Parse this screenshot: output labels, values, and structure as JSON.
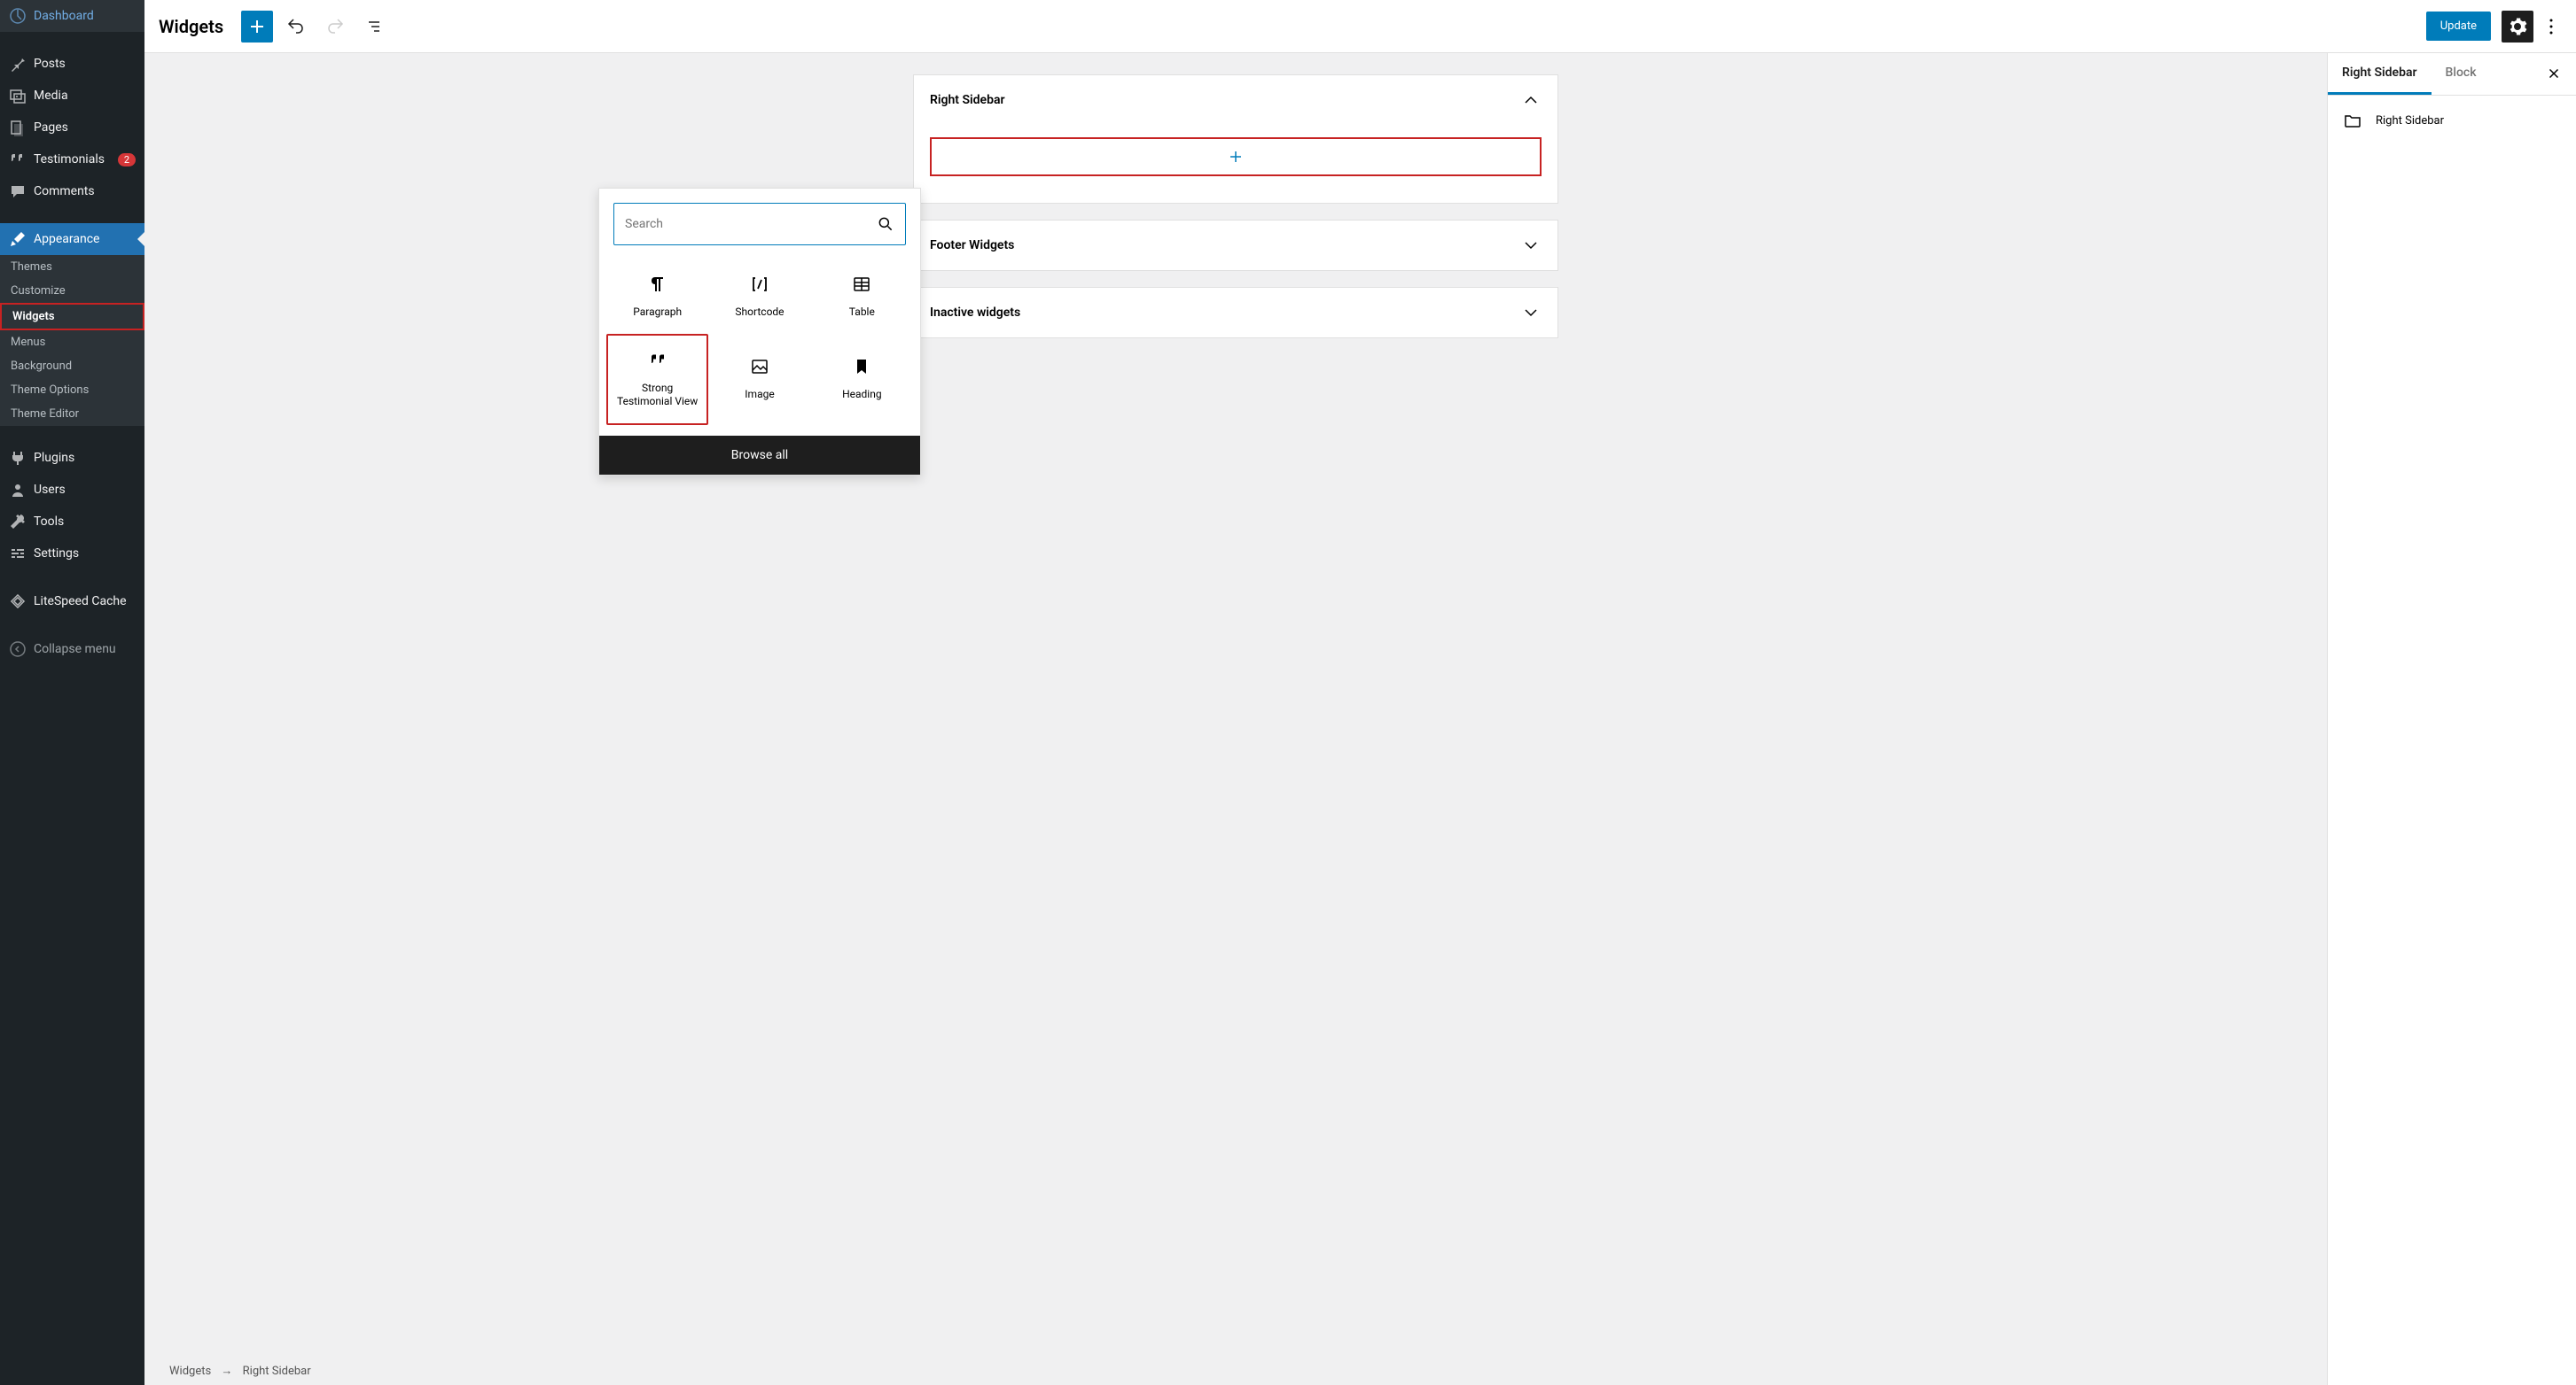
{
  "sidebar": {
    "items": [
      {
        "label": "Dashboard",
        "icon": "dashboard"
      },
      {
        "label": "Posts",
        "icon": "pin"
      },
      {
        "label": "Media",
        "icon": "media"
      },
      {
        "label": "Pages",
        "icon": "page"
      },
      {
        "label": "Testimonials",
        "icon": "quote",
        "badge": "2"
      },
      {
        "label": "Comments",
        "icon": "comment"
      },
      {
        "label": "Appearance",
        "icon": "brush",
        "active": true
      },
      {
        "label": "Plugins",
        "icon": "plug"
      },
      {
        "label": "Users",
        "icon": "user"
      },
      {
        "label": "Tools",
        "icon": "wrench"
      },
      {
        "label": "Settings",
        "icon": "sliders"
      },
      {
        "label": "LiteSpeed Cache",
        "icon": "litespeed"
      },
      {
        "label": "Collapse menu",
        "icon": "collapse"
      }
    ],
    "appearance_submenu": [
      {
        "label": "Themes"
      },
      {
        "label": "Customize"
      },
      {
        "label": "Widgets",
        "current": true,
        "highlighted": true
      },
      {
        "label": "Menus"
      },
      {
        "label": "Background"
      },
      {
        "label": "Theme Options"
      },
      {
        "label": "Theme Editor"
      }
    ]
  },
  "topbar": {
    "title": "Widgets",
    "update_label": "Update"
  },
  "widget_areas": [
    {
      "title": "Right Sidebar",
      "expanded": true
    },
    {
      "title": "Footer Widgets",
      "expanded": false
    },
    {
      "title": "Inactive widgets",
      "expanded": false
    }
  ],
  "inserter": {
    "search_placeholder": "Search",
    "blocks": [
      {
        "label": "Paragraph",
        "icon": "paragraph"
      },
      {
        "label": "Shortcode",
        "icon": "shortcode"
      },
      {
        "label": "Table",
        "icon": "table"
      },
      {
        "label": "Strong Testimonial View",
        "icon": "quote-large",
        "highlighted": true
      },
      {
        "label": "Image",
        "icon": "image"
      },
      {
        "label": "Heading",
        "icon": "bookmark"
      }
    ],
    "browse_label": "Browse all"
  },
  "inspector": {
    "tabs": [
      {
        "label": "Right Sidebar",
        "active": true
      },
      {
        "label": "Block"
      }
    ],
    "current_area": "Right Sidebar"
  },
  "breadcrumb": {
    "root": "Widgets",
    "leaf": "Right Sidebar"
  }
}
